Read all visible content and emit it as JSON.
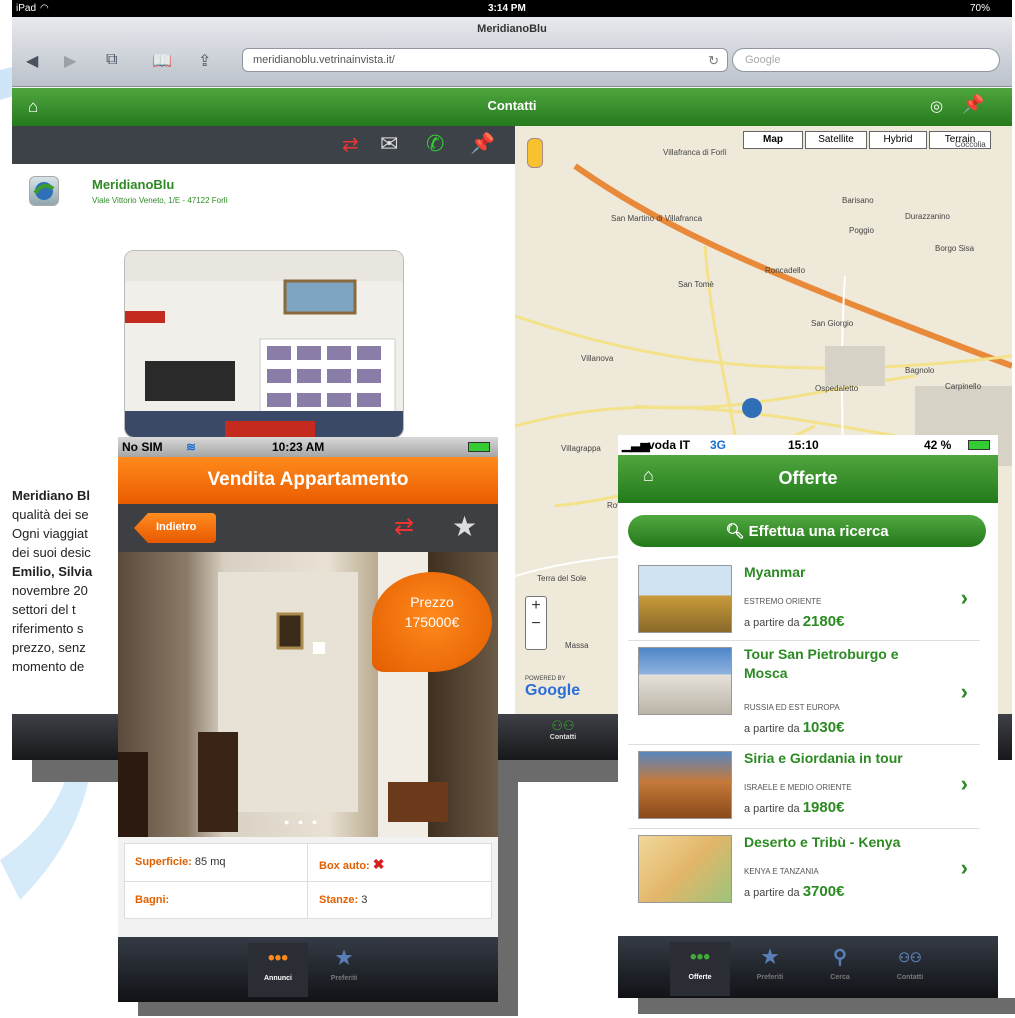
{
  "ipad": {
    "status": {
      "device": "iPad",
      "time": "3:14 PM",
      "battery": "70%"
    },
    "safari": {
      "page_title": "MeridianoBlu",
      "url": "meridianoblu.vetrinainvista.it/",
      "search_placeholder": "Google"
    },
    "header": {
      "title": "Contatti"
    },
    "company": {
      "name": "MeridianoBlu",
      "address": "Viale Vittorio Veneto, 1/E - 47122 Forlì"
    },
    "description_lines": [
      {
        "bold": "Meridiano Bl",
        "text": ""
      },
      {
        "bold": "",
        "text": "qualità dei se"
      },
      {
        "bold": "",
        "text": "Ogni viaggiat"
      },
      {
        "bold": "",
        "text": "dei suoi desic"
      },
      {
        "bold": "Emilio, Silvia",
        "text": ""
      },
      {
        "bold": "",
        "text": "novembre 20"
      },
      {
        "bold": "",
        "text": "settori del t"
      },
      {
        "bold": "",
        "text": "riferimento s"
      },
      {
        "bold": "",
        "text": "prezzo, senz"
      },
      {
        "bold": "",
        "text": "momento de"
      }
    ],
    "map": {
      "types": [
        "Map",
        "Satellite",
        "Hybrid",
        "Terrain"
      ],
      "labels": [
        "Villafranca di Forlì",
        "San Martino di Villafranca",
        "Barisano",
        "Durazzanino",
        "Poggio",
        "Borgo Sisa",
        "San Tomè",
        "Roncadello",
        "San Giorgio",
        "Villanova",
        "Ospedaletto",
        "Bagnolo",
        "Carpinello",
        "Villagrappa",
        "Rovere",
        "Terra del Sole",
        "Massa",
        "Coccolia"
      ],
      "powered": "POWERED BY",
      "google": "Google"
    },
    "tabbar": {
      "contact_label": "Contatti"
    }
  },
  "phone1": {
    "status": {
      "carrier": "No SIM",
      "time": "10:23 AM"
    },
    "title": "Vendita Appartamento",
    "back_label": "Indietro",
    "price": {
      "label": "Prezzo",
      "value": "175000€"
    },
    "details": [
      {
        "key": "Superficie:",
        "value": "85 mq"
      },
      {
        "key": "Box auto:",
        "value": "✖"
      },
      {
        "key": "Bagni:",
        "value": ""
      },
      {
        "key": "Stanze:",
        "value": "3"
      }
    ],
    "tabs": [
      {
        "label": "Annunci",
        "icon": "dots-icon"
      },
      {
        "label": "Preferiti",
        "icon": "star-icon"
      }
    ]
  },
  "phone2": {
    "status": {
      "carrier": "voda IT",
      "network": "3G",
      "time": "15:10",
      "battery": "42 %"
    },
    "title": "Offerte",
    "search_label": "Effettua una ricerca",
    "offers": [
      {
        "title": "Myanmar",
        "region": "ESTREMO ORIENTE",
        "prefix": "a partire da",
        "price": "2180€"
      },
      {
        "title": "Tour San Pietroburgo e Mosca",
        "region": "RUSSIA ED EST EUROPA",
        "prefix": "a partire da",
        "price": "1030€"
      },
      {
        "title": "Siria e Giordania in tour",
        "region": "ISRAELE E MEDIO ORIENTE",
        "prefix": "a partire da",
        "price": "1980€"
      },
      {
        "title": "Deserto e Tribù - Kenya",
        "region": "KENYA E TANZANIA",
        "prefix": "a partire da",
        "price": "3700€"
      }
    ],
    "tabs": [
      {
        "label": "Offerte"
      },
      {
        "label": "Preferiti"
      },
      {
        "label": "Cerca"
      },
      {
        "label": "Contatti"
      }
    ]
  },
  "colors": {
    "green": "#2b8a22",
    "orange": "#ea5c00",
    "dark": "#3d4148"
  }
}
